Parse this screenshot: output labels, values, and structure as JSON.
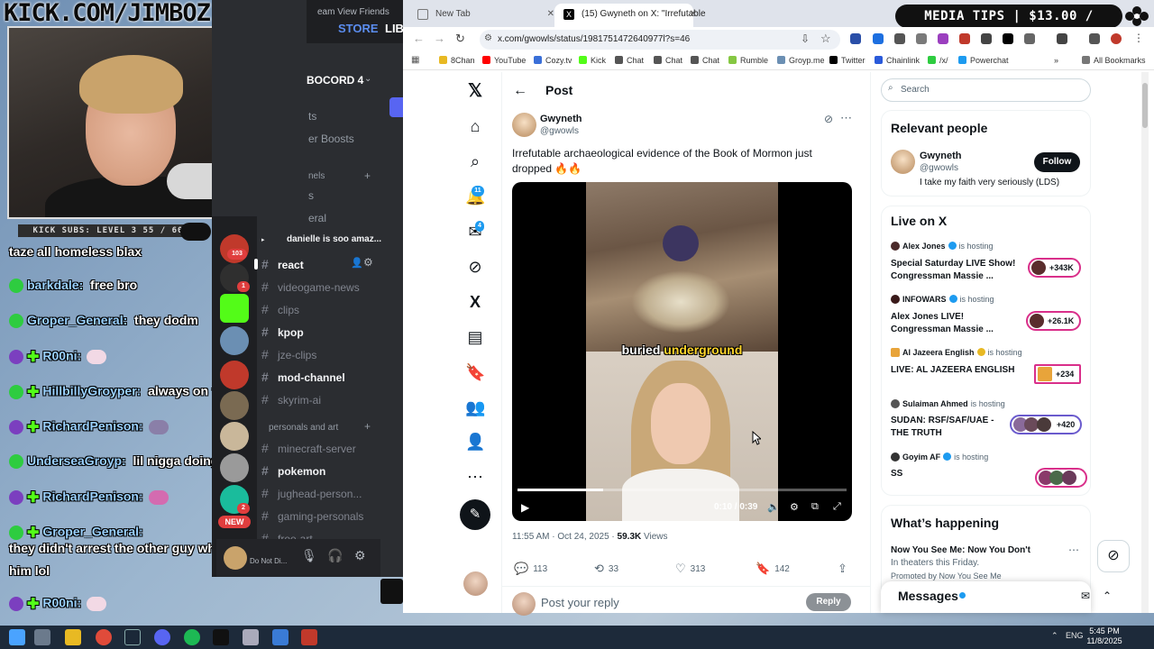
{
  "stream": {
    "kick_url": "KICK.COM/JIMBOZ",
    "subs_label": "KICK SUBS: LEVEL 3 55 / 60",
    "media_tips": "MEDIA TIPS | $13.00 / $200.00",
    "chat": [
      {
        "user": "",
        "text": "taze all homeless blax",
        "badge": ""
      },
      {
        "user": "barkdale:",
        "text": "free bro",
        "badge": "green"
      },
      {
        "user": "Groper_General:",
        "text": "they dodm",
        "badge": "green"
      },
      {
        "user": "R00ni:",
        "text": "",
        "badge": "purple"
      },
      {
        "user": "HillbillyGroyper:",
        "text": "always on that phone",
        "badge": "green"
      },
      {
        "user": "RichardPenison:",
        "text": "",
        "badge": "purple"
      },
      {
        "user": "UnderseaGroyp:",
        "text": "lil nigga doing the worm",
        "badge": "green"
      },
      {
        "user": "RichardPenison:",
        "text": "",
        "badge": "purple"
      },
      {
        "user": "Groper_General:",
        "text": "",
        "badge": "green"
      },
      {
        "user": "",
        "text": "they didn't arrest the other guy who assaulted",
        "badge": ""
      },
      {
        "user": "",
        "text": "him lol",
        "badge": ""
      },
      {
        "user": "R00ni:",
        "text": "",
        "badge": "purple"
      }
    ]
  },
  "discord": {
    "top_menu": "eam   View   Friends",
    "store": "STORE",
    "library": "LIBI",
    "server_name": "BOCORD 4",
    "partial_1": "ts",
    "partial_2": "er Boosts",
    "partial_3": "nels",
    "partial_4": "s",
    "partial_5": "eral",
    "channels": [
      {
        "name": "danielle is soo amaz...",
        "style": "bright"
      },
      {
        "name": "react",
        "style": "active"
      },
      {
        "name": "videogame-news",
        "style": ""
      },
      {
        "name": "clips",
        "style": ""
      },
      {
        "name": "kpop",
        "style": "bright"
      },
      {
        "name": "jze-clips",
        "style": ""
      },
      {
        "name": "mod-channel",
        "style": "bright"
      },
      {
        "name": "skyrim-ai",
        "style": ""
      }
    ],
    "category": "personals and art",
    "channels2": [
      {
        "name": "minecraft-server",
        "style": ""
      },
      {
        "name": "pokemon",
        "style": "bright"
      },
      {
        "name": "jughead-person...",
        "style": ""
      },
      {
        "name": "gaming-personals",
        "style": ""
      },
      {
        "name": "free-art",
        "style": ""
      }
    ],
    "server_badges": [
      "103",
      "1",
      "2"
    ],
    "new_label": "NEW",
    "user_status": "Do Not Di..."
  },
  "browser": {
    "tabs": [
      {
        "label": "New Tab"
      },
      {
        "label": "(15) Gwyneth on X: \"Irrefutable"
      }
    ],
    "url": "x.com/gwowls/status/1981751472640977l?s=46",
    "bookmarks": [
      "8Chan",
      "YouTube",
      "Cozy.tv",
      "Kick",
      "Chat",
      "Chat",
      "Chat",
      "Rumble",
      "Groyp.me",
      "Twitter",
      "Chainlink",
      "/x/",
      "Powerchat"
    ],
    "all_bookmarks": "All Bookmarks"
  },
  "x": {
    "nav_badges": {
      "notifications": "11",
      "messages": "4"
    },
    "header": "Post",
    "author": {
      "name": "Gwyneth",
      "handle": "@gwowls"
    },
    "tweet_text": "Irrefutable archaeological evidence of the Book of Mormon just dropped 🔥🔥",
    "video": {
      "caption_white": "buried ",
      "caption_yellow": "underground",
      "time": "0:10 / 0:39",
      "progress": 0.26
    },
    "meta": {
      "time": "11:55 AM · Oct 24, 2025 · ",
      "views": "59.3K",
      "views_label": " Views"
    },
    "actions": {
      "replies": "113",
      "reposts": "33",
      "likes": "313",
      "bookmarks": "142"
    },
    "reply_placeholder": "Post your reply",
    "reply_button": "Reply",
    "search_placeholder": "Search",
    "relevant": {
      "heading": "Relevant people",
      "name": "Gwyneth",
      "handle": "@gwowls",
      "bio": "I take my faith very seriously (LDS)",
      "follow": "Follow"
    },
    "live": {
      "heading": "Live on X",
      "hosting_label": "is hosting",
      "items": [
        {
          "host": "Alex Jones",
          "title": "Special Saturday LIVE Show! Congressman Massie ...",
          "count": "+343K",
          "verified": "blue"
        },
        {
          "host": "INFOWARS",
          "title": "Alex Jones LIVE! Congressman Massie ...",
          "count": "+26.1K",
          "verified": "blue"
        },
        {
          "host": "Al Jazeera English",
          "title": "LIVE: AL JAZEERA ENGLISH",
          "count": "+234",
          "verified": "gold"
        },
        {
          "host": "Sulaiman Ahmed",
          "title": "SUDAN: RSF/SAF/UAE - THE TRUTH",
          "count": "+420",
          "verified": ""
        },
        {
          "host": "Goyim AF",
          "title": "SS",
          "count": "",
          "verified": "blue"
        }
      ]
    },
    "happening": {
      "heading": "What’s happening",
      "title": "Now You See Me: Now You Don't",
      "sub": "In theaters this Friday.",
      "promo": "Promoted by Now You See Me"
    },
    "messages": "Messages"
  },
  "taskbar": {
    "lang": "ENG",
    "time": "5:45 PM",
    "date": "11/8/2025"
  },
  "colors": {
    "x_blue": "#1d9bf0",
    "live_pink": "#d92f8a",
    "kick_green": "#53fc18",
    "discord_bg": "#2b2d31"
  }
}
